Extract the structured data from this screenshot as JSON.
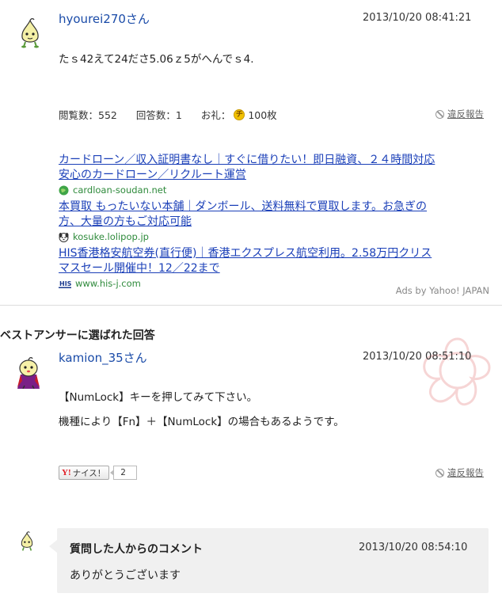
{
  "question": {
    "username": "hyourei270さん",
    "timestamp": "2013/10/20  08:41:21",
    "body": "たｓ42えて24ださ5.06ｚ5がへんでｓ4.",
    "stats": {
      "views_label": "閲覧数：552",
      "answers_label": "回答数：1",
      "reward_prefix": "お礼：",
      "coin_glyph": "チ",
      "reward_value": "100枚"
    },
    "report_label": "違反報告"
  },
  "ads": {
    "items": [
      {
        "title_line1": "カードローン／収入証明書なし｜すぐに借りたい！即日融資、２４時間対応",
        "title_line2": "安心のカードローン／リクルート運営",
        "domain": "cardloan-soudan.net",
        "icon": "green-globe-icon"
      },
      {
        "title_line1": "本買取 もったいない本舗｜ダンボール、送料無料で買取します。お急ぎの",
        "title_line2": "方、大量の方もご対応可能",
        "domain": "kosuke.lolipop.jp",
        "icon": "dog-face-icon"
      },
      {
        "title_line1": "HIS香港格安航空券(直行便)｜香港エクスプレス航空利用。2.58万円クリス",
        "title_line2": "マスセール開催中！12／22まで",
        "domain": "www.his-j.com",
        "icon": "his-logo-icon"
      }
    ],
    "ads_by": "Ads by Yahoo! JAPAN"
  },
  "best_answer": {
    "heading": "ベストアンサーに選ばれた回答",
    "username": "kamion_35さん",
    "timestamp": "2013/10/20  08:51:10",
    "line1": "【NumLock】キーを押してみて下さい。",
    "line2": "機種により【Fn】＋【NumLock】の場合もあるようです。",
    "nice_y": "Y!",
    "nice_label": "ナイス！",
    "nice_count": "2",
    "report_label": "違反報告"
  },
  "comment": {
    "title": "質問した人からのコメント",
    "timestamp": "2013/10/20 08:54:10",
    "text": "ありがとうございます"
  },
  "colors": {
    "link": "#1a3fb8",
    "username": "#1a4ba8",
    "domain": "#2e8a3b",
    "comment_bg": "#f0f0f0",
    "stamp": "#e88a8a"
  }
}
